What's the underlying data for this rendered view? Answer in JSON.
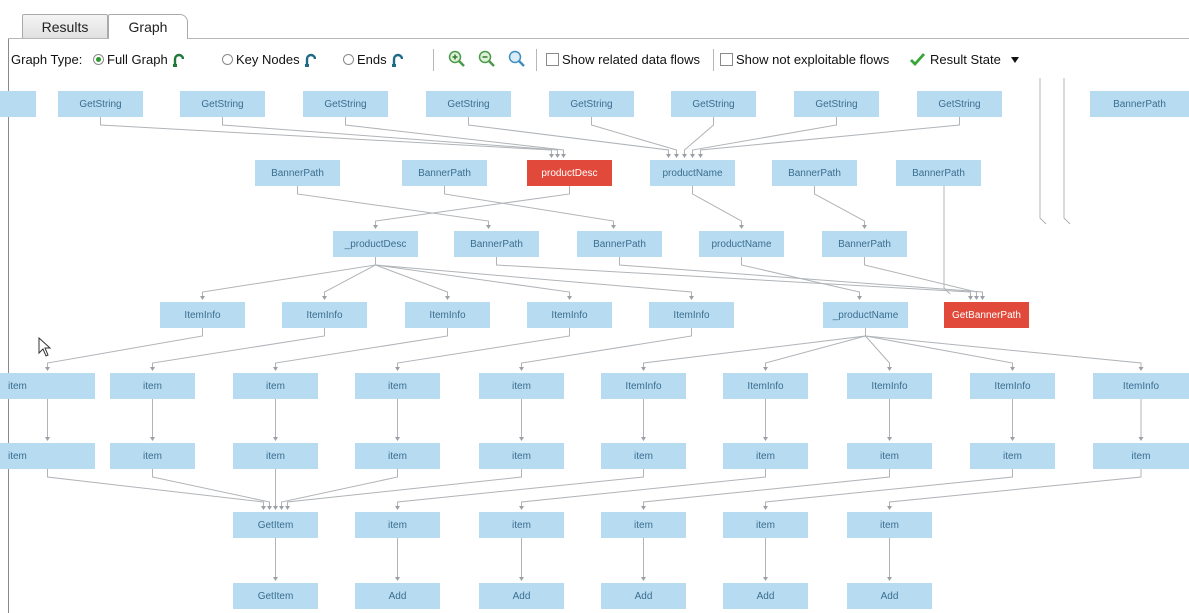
{
  "tabs": {
    "results": "Results",
    "graph": "Graph"
  },
  "toolbar": {
    "graph_type_label": "Graph Type:",
    "option_full": "Full Graph",
    "option_key": "Key Nodes",
    "option_ends": "Ends",
    "selected": "Full Graph",
    "show_related": "Show related data flows",
    "show_not_exploitable": "Show not exploitable flows",
    "result_state": "Result State"
  },
  "colors": {
    "node_bg": "#b7dcf2",
    "node_text": "#3c6d8e",
    "highlight_bg": "#e14a3b",
    "edge": "#b0b4b8"
  },
  "graph": {
    "rows": [
      [
        "GetString",
        "GetString",
        "GetString",
        "GetString",
        "GetString",
        "GetString",
        "GetString",
        "GetString",
        "BannerPath"
      ],
      [
        "BannerPath",
        "BannerPath",
        "productDesc",
        "productName",
        "BannerPath",
        "BannerPath"
      ],
      [
        "_productDesc",
        "BannerPath",
        "BannerPath",
        "productName",
        "BannerPath"
      ],
      [
        "ItemInfo",
        "ItemInfo",
        "ItemInfo",
        "ItemInfo",
        "ItemInfo",
        "_productName",
        "GetBannerPath"
      ],
      [
        "item",
        "item",
        "item",
        "item",
        "item",
        "ItemInfo",
        "ItemInfo",
        "ItemInfo",
        "ItemInfo",
        "ItemInfo"
      ],
      [
        "item",
        "item",
        "item",
        "item",
        "item",
        "item",
        "item",
        "item",
        "item",
        "item"
      ],
      [
        "GetItem",
        "item",
        "item",
        "item",
        "item",
        "item"
      ],
      [
        "GetItem",
        "Add",
        "Add",
        "Add",
        "Add",
        "Add"
      ]
    ],
    "highlighted": [
      "productDesc",
      "GetBannerPath"
    ]
  }
}
